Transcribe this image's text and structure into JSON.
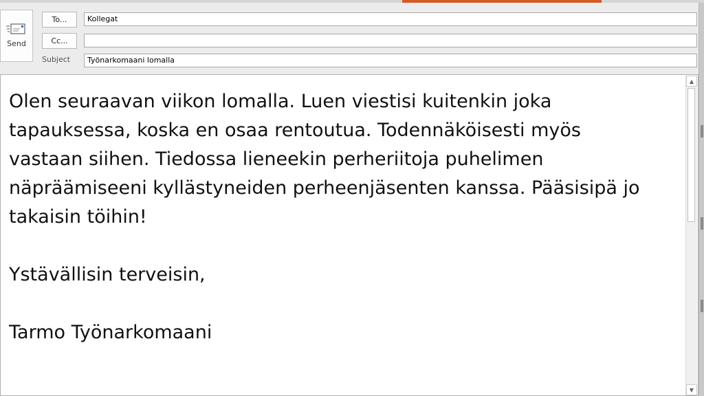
{
  "header": {
    "send_label": "Send",
    "to_label": "To...",
    "cc_label": "Cc...",
    "subject_label": "Subject"
  },
  "fields": {
    "to_value": "Kollegat",
    "cc_value": "",
    "subject_value": "Työnarkomaani lomalla"
  },
  "message": {
    "body": "Olen seuraavan viikon lomalla. Luen viestisi kuitenkin joka\ntapauksessa, koska en osaa rentoutua. Todennäköisesti myös\nvastaan siihen. Tiedossa lieneekin perheriitoja puhelimen\nnäpräämiseeni kyllästyneiden perheenjäsenten kanssa. Pääsisipä jo\ntakaisin töihin!\n\nYstävällisin terveisin,\n\nTarmo Työnarkomaani"
  },
  "scrollbar": {
    "up_arrow": "▲",
    "down_arrow": "▼"
  },
  "colors": {
    "accent": "#d35c25",
    "background": "#ececec"
  },
  "icons": {
    "send": "send-mail-icon"
  }
}
